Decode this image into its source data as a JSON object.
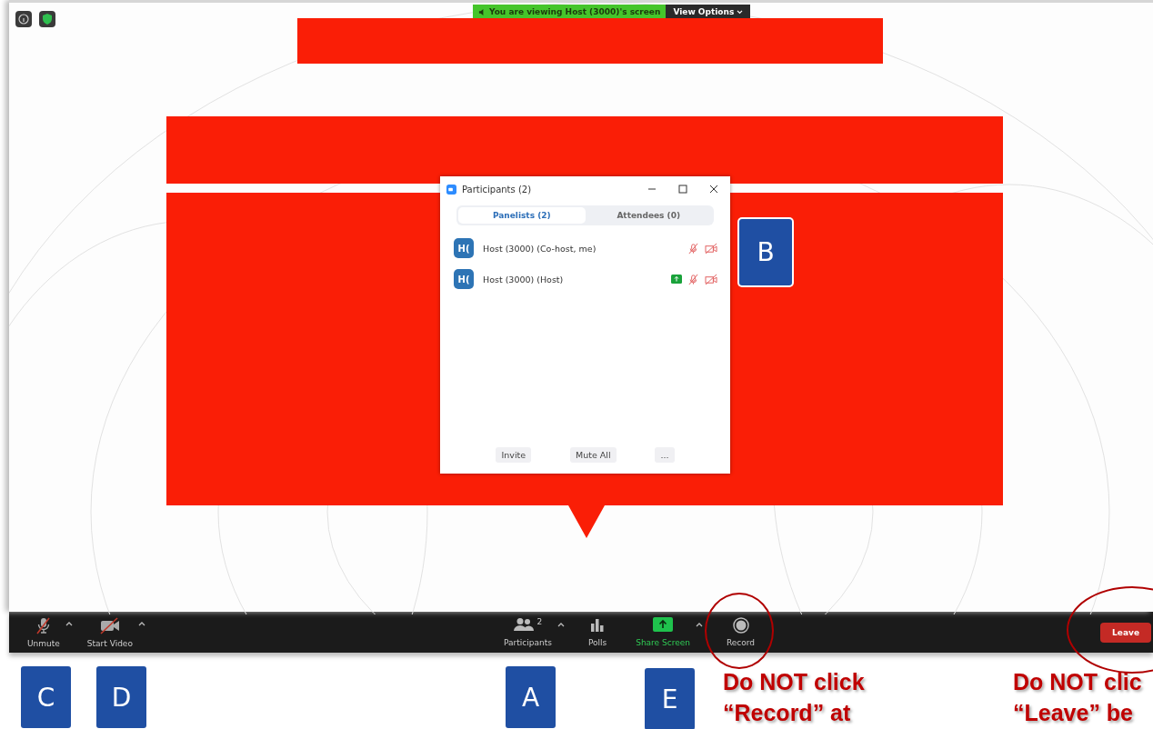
{
  "top_bar": {
    "viewing_banner": "You are viewing Host (3000)'s screen",
    "view_options": "View Options"
  },
  "participants_window": {
    "title": "Participants (2)",
    "tabs": [
      {
        "label": "Panelists (2)",
        "selected": true
      },
      {
        "label": "Attendees (0)",
        "selected": false
      }
    ],
    "participants": [
      {
        "avatar": "H(",
        "name": "Host (3000) (Co-host, me)",
        "sharing": false
      },
      {
        "avatar": "H(",
        "name": "Host (3000) (Host)",
        "sharing": true
      }
    ],
    "buttons": [
      "Invite",
      "Mute All",
      "..."
    ]
  },
  "toolbar": {
    "left": [
      {
        "kind": "mic",
        "label": "Unmute",
        "menu": true
      },
      {
        "kind": "video",
        "label": "Start Video",
        "menu": true
      }
    ],
    "center": [
      {
        "kind": "participants",
        "label": "Participants",
        "count": "2",
        "menu": true
      },
      {
        "kind": "polls",
        "label": "Polls",
        "menu": false
      },
      {
        "kind": "share",
        "label": "Share Screen",
        "menu": true
      },
      {
        "kind": "record",
        "label": "Record",
        "menu": false
      }
    ],
    "leave": "Leave"
  },
  "callouts": [
    "B",
    "C",
    "D",
    "A",
    "E"
  ],
  "notes": [
    [
      "Do NOT click",
      "“Record” at"
    ],
    [
      "Do NOT clic",
      "“Leave” be"
    ]
  ]
}
